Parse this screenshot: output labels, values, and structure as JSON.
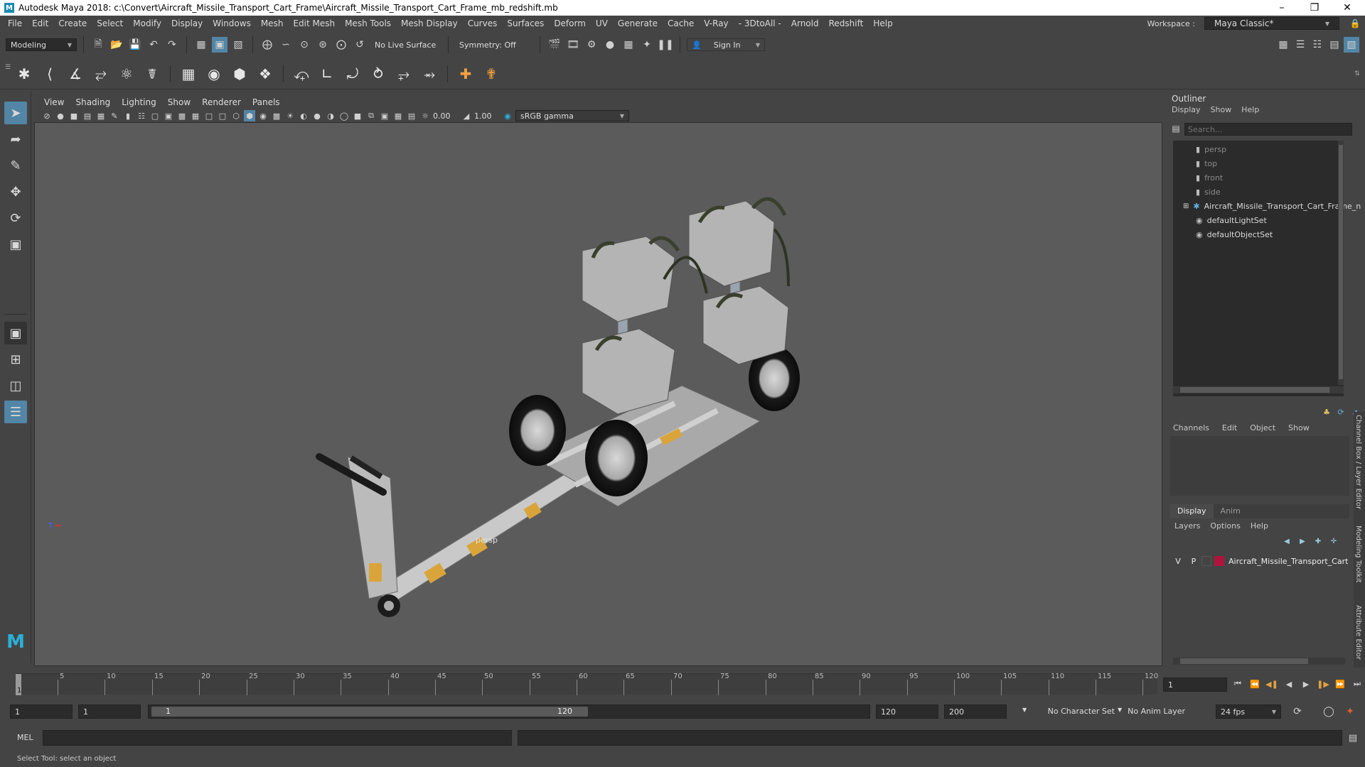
{
  "window": {
    "title": "Autodesk Maya 2018: c:\\Convert\\Aircraft_Missile_Transport_Cart_Frame\\Aircraft_Missile_Transport_Cart_Frame_mb_redshift.mb",
    "logo_letter": "M"
  },
  "menus": [
    "File",
    "Edit",
    "Create",
    "Select",
    "Modify",
    "Display",
    "Windows",
    "Mesh",
    "Edit Mesh",
    "Mesh Tools",
    "Mesh Display",
    "Curves",
    "Surfaces",
    "Deform",
    "UV",
    "Generate",
    "Cache",
    "V-Ray",
    "- 3DtoAll -",
    "Arnold",
    "Redshift",
    "Help"
  ],
  "workspace": {
    "label": "Workspace :",
    "value": "Maya Classic*"
  },
  "statusline": {
    "mode": "Modeling",
    "live_surface": "No Live Surface",
    "symmetry": "Symmetry: Off",
    "sign_in": "Sign In"
  },
  "panel": {
    "menus": [
      "View",
      "Shading",
      "Lighting",
      "Show",
      "Renderer",
      "Panels"
    ],
    "exposure": "0.00",
    "gamma": "1.00",
    "color_space": "sRGB gamma",
    "camera_label": "persp"
  },
  "outliner": {
    "title": "Outliner",
    "menus": [
      "Display",
      "Show",
      "Help"
    ],
    "search_placeholder": "Search...",
    "items": [
      {
        "label": "persp",
        "dim": true,
        "icon": "camera-icon"
      },
      {
        "label": "top",
        "dim": true,
        "icon": "camera-icon"
      },
      {
        "label": "front",
        "dim": true,
        "icon": "camera-icon"
      },
      {
        "label": "side",
        "dim": true,
        "icon": "camera-icon"
      },
      {
        "label": "Aircraft_Missile_Transport_Cart_Frame_n",
        "dim": false,
        "icon": "group-icon"
      },
      {
        "label": "defaultLightSet",
        "dim": false,
        "icon": "set-icon"
      },
      {
        "label": "defaultObjectSet",
        "dim": false,
        "icon": "set-icon"
      }
    ]
  },
  "channelbox": {
    "menus": [
      "Channels",
      "Edit",
      "Object",
      "Show"
    ]
  },
  "layereditor": {
    "tabs": [
      "Display",
      "Anim"
    ],
    "menus": [
      "Layers",
      "Options",
      "Help"
    ],
    "layer": {
      "v": "V",
      "p": "P",
      "name": "Aircraft_Missile_Transport_Cart",
      "color": "#b0143c"
    }
  },
  "side_tabs": [
    "Channel Box / Layer Editor",
    "Modeling Toolkit",
    "Attribute Editor"
  ],
  "timeline": {
    "ticks": [
      "5",
      "10",
      "15",
      "20",
      "25",
      "30",
      "35",
      "40",
      "45",
      "50",
      "55",
      "60",
      "65",
      "70",
      "75",
      "80",
      "85",
      "90",
      "95",
      "100",
      "105",
      "110",
      "115",
      "120"
    ],
    "current_marker": "1",
    "current_frame": "1"
  },
  "range": {
    "start": "1",
    "playback_start": "1",
    "slider_start": "1",
    "slider_end": "120",
    "playback_end": "120",
    "end": "200",
    "character_set": "No Character Set",
    "anim_layer": "No Anim Layer",
    "fps": "24 fps"
  },
  "cmd": {
    "label": "MEL"
  },
  "help_line": "Select Tool: select an object"
}
